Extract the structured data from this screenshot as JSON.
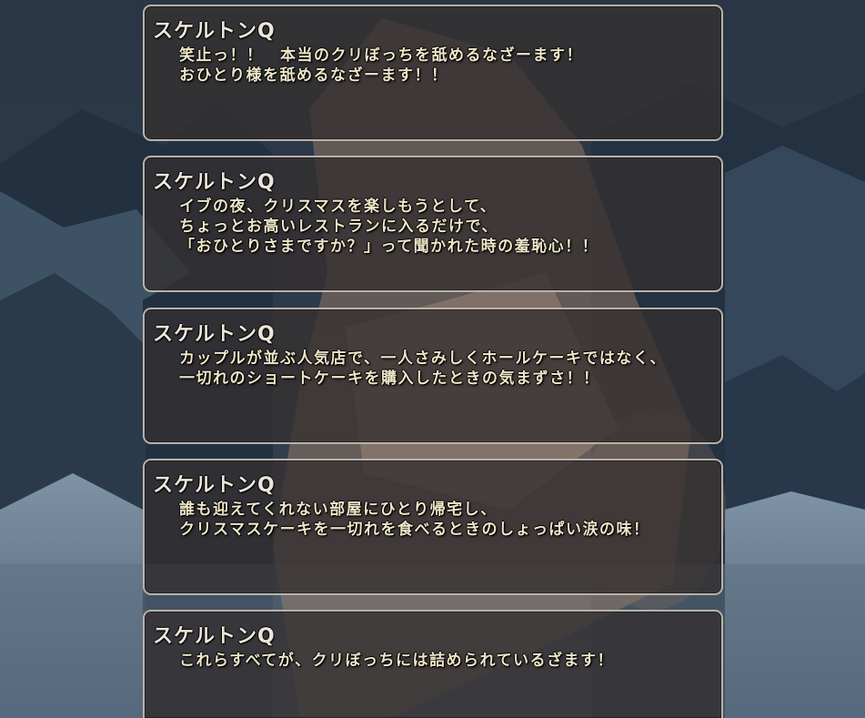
{
  "messages": [
    {
      "speaker": "スケルトンQ",
      "lines": [
        "笑止っ！！　本当のクリぼっちを舐めるなざーます！",
        "おひとり様を舐めるなざーます！！"
      ]
    },
    {
      "speaker": "スケルトンQ",
      "lines": [
        "イブの夜、クリスマスを楽しもうとして、",
        "ちょっとお高いレストランに入るだけで、",
        "「おひとりさまですか？」って聞かれた時の羞恥心！！"
      ]
    },
    {
      "speaker": "スケルトンQ",
      "lines": [
        "カップルが並ぶ人気店で、一人さみしくホールケーキではなく、",
        "一切れのショートケーキを購入したときの気まずさ！！"
      ]
    },
    {
      "speaker": "スケルトンQ",
      "lines": [
        "誰も迎えてくれない部屋にひとり帰宅し、",
        "クリスマスケーキを一切れを食べるときのしょっぱい涙の味！"
      ]
    },
    {
      "speaker": "スケルトンQ",
      "lines": [
        "これらすべてが、クリぼっちには詰められているざます！"
      ]
    }
  ]
}
